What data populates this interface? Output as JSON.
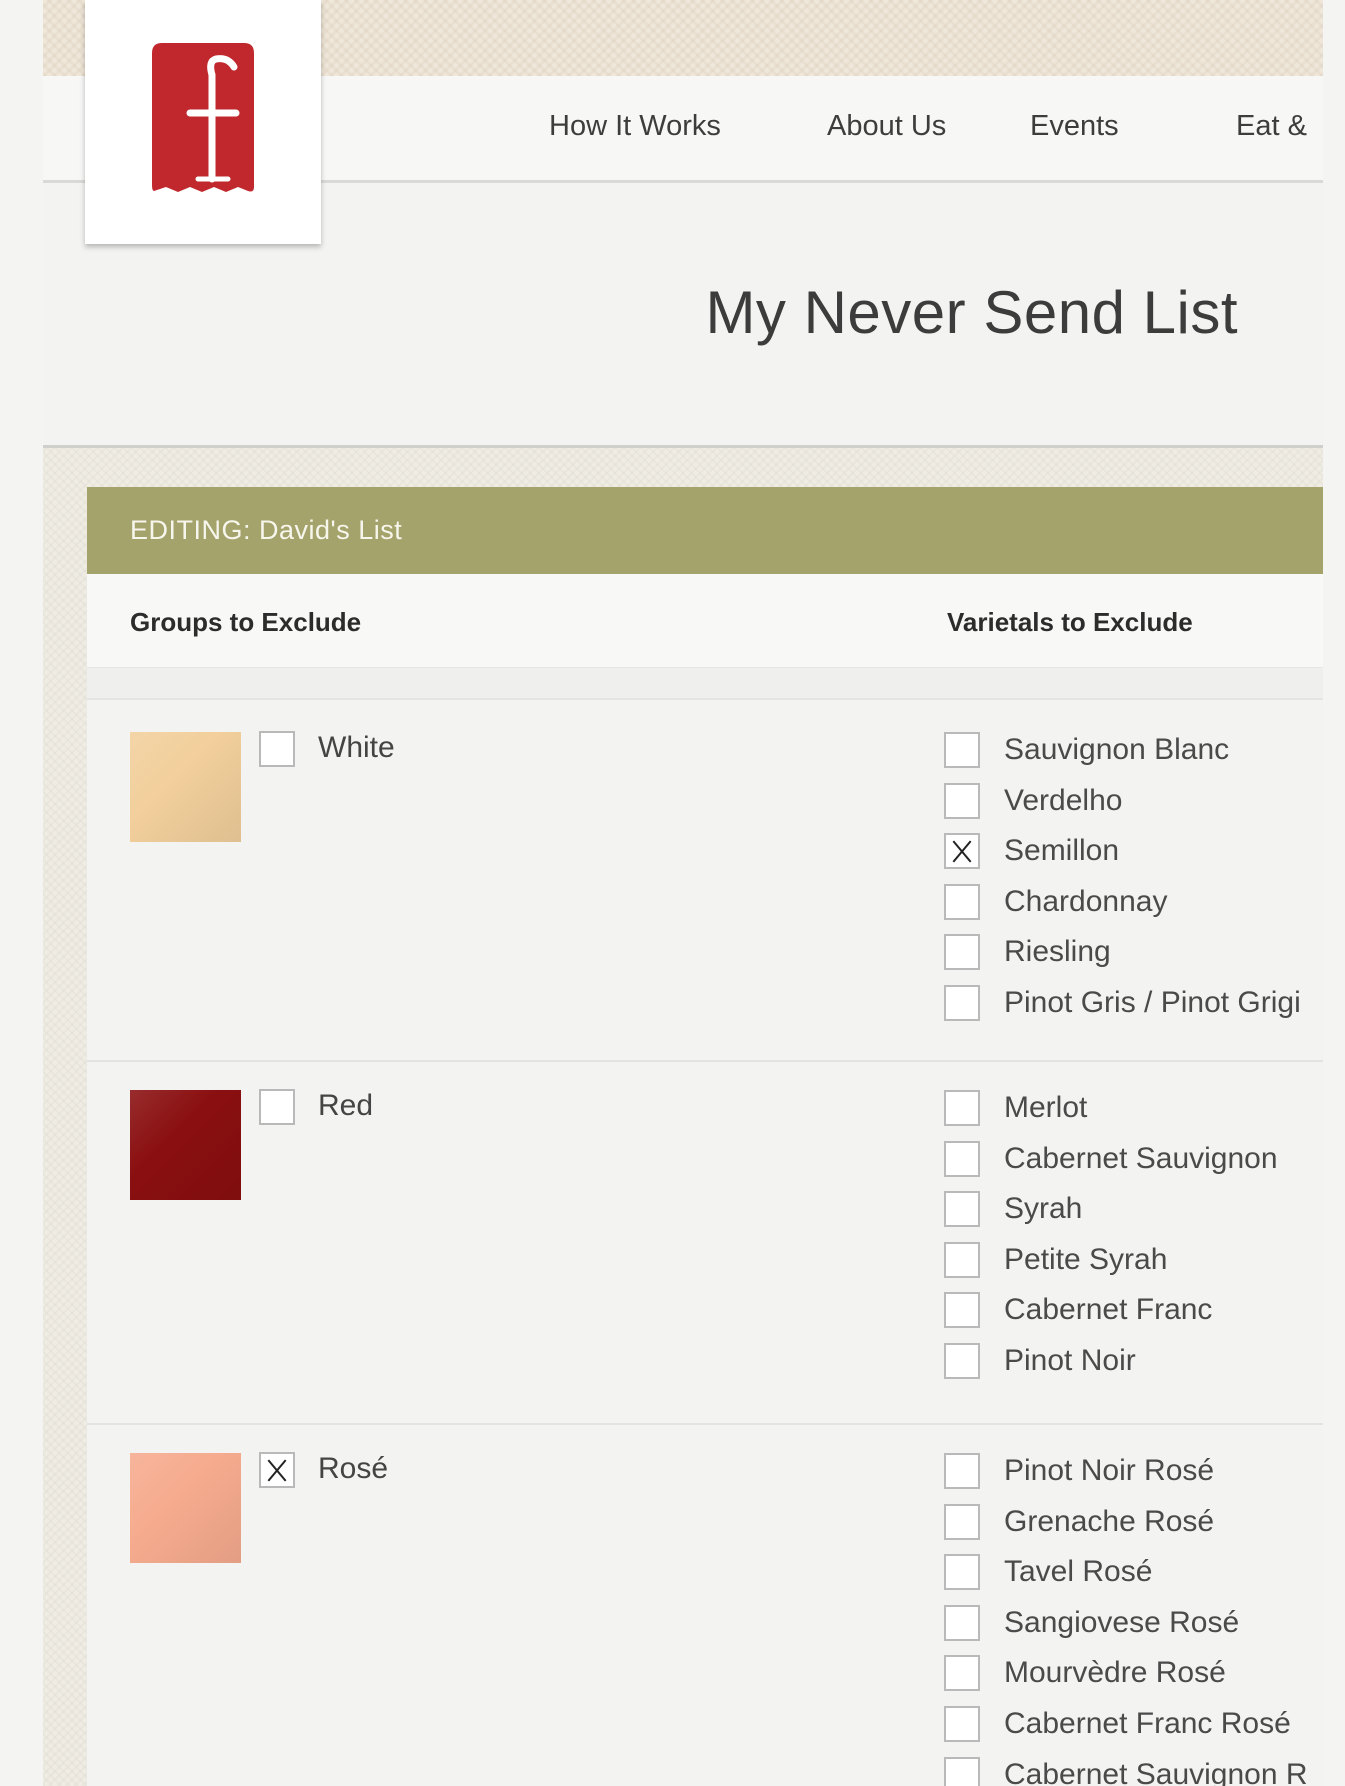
{
  "nav": {
    "links": [
      "How It Works",
      "About Us",
      "Events",
      "Eat &"
    ]
  },
  "page": {
    "title": "My Never Send List"
  },
  "panel": {
    "editing_label": "EDITING: David's List",
    "groups_heading": "Groups to Exclude",
    "varietals_heading": "Varietals to Exclude"
  },
  "groups": [
    {
      "label": "White",
      "checked": false,
      "swatch_color": "#f2cf9c",
      "varietals": [
        {
          "label": "Sauvignon Blanc",
          "checked": false
        },
        {
          "label": "Verdelho",
          "checked": false
        },
        {
          "label": "Semillon",
          "checked": true
        },
        {
          "label": "Chardonnay",
          "checked": false
        },
        {
          "label": "Riesling",
          "checked": false
        },
        {
          "label": "Pinot Gris / Pinot Grigi",
          "checked": false
        }
      ]
    },
    {
      "label": "Red",
      "checked": false,
      "swatch_color": "#8a0f10",
      "varietals": [
        {
          "label": "Merlot",
          "checked": false
        },
        {
          "label": "Cabernet Sauvignon",
          "checked": false
        },
        {
          "label": "Syrah",
          "checked": false
        },
        {
          "label": "Petite Syrah",
          "checked": false
        },
        {
          "label": "Cabernet Franc",
          "checked": false
        },
        {
          "label": "Pinot Noir",
          "checked": false
        }
      ]
    },
    {
      "label": "Rosé",
      "checked": true,
      "swatch_color": "#f6ab8e",
      "varietals": [
        {
          "label": "Pinot Noir Rosé",
          "checked": false
        },
        {
          "label": "Grenache Rosé",
          "checked": false
        },
        {
          "label": "Tavel Rosé",
          "checked": false
        },
        {
          "label": "Sangiovese Rosé",
          "checked": false
        },
        {
          "label": "Mourvèdre Rosé",
          "checked": false
        },
        {
          "label": "Cabernet Franc Rosé",
          "checked": false
        },
        {
          "label": "Cabernet Sauvignon R",
          "checked": false
        }
      ]
    }
  ],
  "colors": {
    "brand_red": "#c0282d",
    "header_olive": "#a5a36c"
  }
}
